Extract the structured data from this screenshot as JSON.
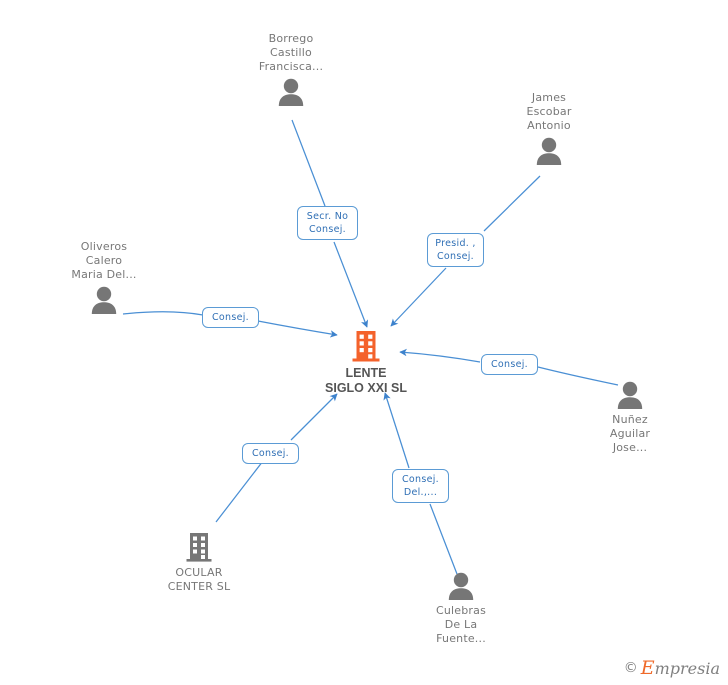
{
  "diagram": {
    "type": "company-relationship-graph",
    "center_company": "LENTE\nSIGLO XXI SL",
    "accent_company_color": "#f4622b",
    "accent_edge_color": "#4a8fd4",
    "person_icon_color": "#767676",
    "subsidiary_icon_color": "#777777"
  },
  "nodes": [
    {
      "id": "borrego",
      "kind": "person",
      "label": "Borrego\nCastillo\nFrancisca...",
      "icon": "person-icon"
    },
    {
      "id": "james",
      "kind": "person",
      "label": "James\nEscobar\nAntonio",
      "icon": "person-icon"
    },
    {
      "id": "oliveros",
      "kind": "person",
      "label": "Oliveros\nCalero\nMaria Del...",
      "icon": "person-icon"
    },
    {
      "id": "nunez",
      "kind": "person",
      "label": "Nuñez\nAguilar\nJose...",
      "icon": "person-icon"
    },
    {
      "id": "culebras",
      "kind": "person",
      "label": "Culebras\nDe La\nFuente...",
      "icon": "person-icon"
    },
    {
      "id": "ocular",
      "kind": "company",
      "label": "OCULAR\nCENTER SL",
      "icon": "building-icon"
    },
    {
      "id": "lente",
      "kind": "company-center",
      "label": "LENTE\nSIGLO XXI SL",
      "icon": "building-icon"
    }
  ],
  "edge_labels": [
    {
      "id": "edge-borrego",
      "text": "Secr. No\nConsej."
    },
    {
      "id": "edge-james",
      "text": "Presid. ,\nConsej."
    },
    {
      "id": "edge-oliveros",
      "text": "Consej."
    },
    {
      "id": "edge-nunez",
      "text": "Consej."
    },
    {
      "id": "edge-ocular",
      "text": "Consej."
    },
    {
      "id": "edge-culebras",
      "text": "Consej.\nDel.,..."
    }
  ],
  "watermark": {
    "copyright": "©",
    "brand_initial": "E",
    "brand_rest": "mpresia"
  }
}
